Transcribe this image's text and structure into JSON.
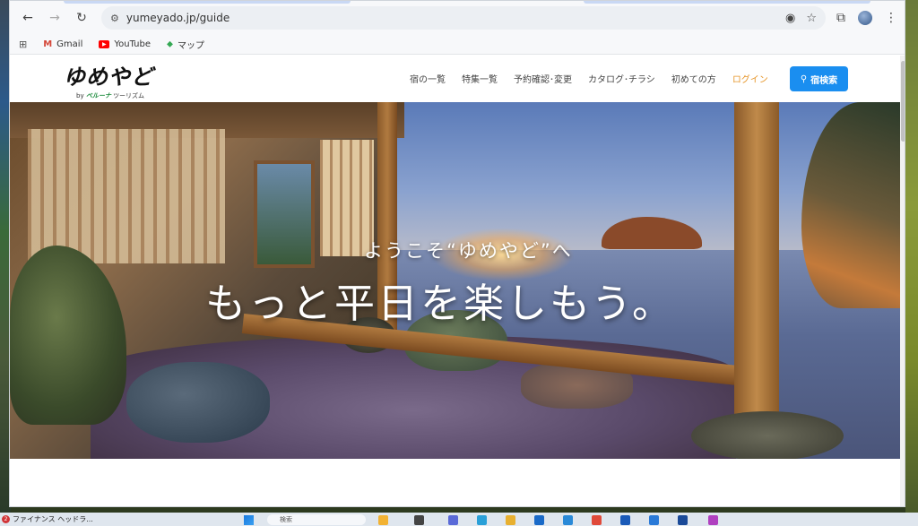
{
  "browser": {
    "url": "yumeyado.jp/guide",
    "bookmarks": [
      {
        "label": "Gmail",
        "icon": "gmail-icon"
      },
      {
        "label": "YouTube",
        "icon": "youtube-icon"
      },
      {
        "label": "マップ",
        "icon": "maps-icon"
      }
    ]
  },
  "site": {
    "logo": {
      "main": "ゆめやど",
      "sub_prefix": "by",
      "sub_brand": "ベルーナ",
      "sub_suffix": "ツーリズム"
    },
    "nav": {
      "item1": "宿の一覧",
      "item2": "特集一覧",
      "item3": "予約確認･変更",
      "item4": "カタログ･チラシ",
      "item5": "初めての方",
      "login": "ログイン"
    },
    "search_button": "宿検索",
    "hero": {
      "welcome": "ようこそ“ゆめやど”へ",
      "tagline": "もっと平日を楽しもう。"
    }
  },
  "taskbar": {
    "badge": "2",
    "news": "ファイナンス ヘッドラ...",
    "search_placeholder": "検索"
  },
  "colors": {
    "accent_blue": "#1a8ef0",
    "login_orange": "#e6962a"
  }
}
